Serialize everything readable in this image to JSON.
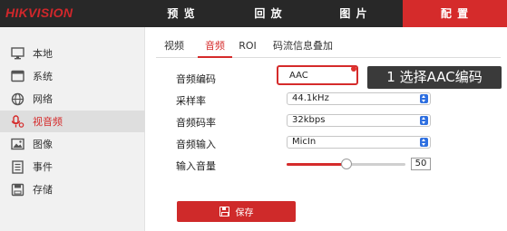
{
  "brand": {
    "logo": "HIKVISION",
    "logo_color": "#d1272b"
  },
  "topnav": [
    {
      "label": "预 览",
      "icon": "none"
    },
    {
      "label": "回 放",
      "icon": "none"
    },
    {
      "label": "图 片",
      "icon": "none"
    },
    {
      "label": "配 置",
      "icon": "none",
      "active": true
    }
  ],
  "sidebar": {
    "items": [
      {
        "label": "本地",
        "icon": "monitor-icon"
      },
      {
        "label": "系统",
        "icon": "window-icon"
      },
      {
        "label": "网络",
        "icon": "globe-icon"
      },
      {
        "label": "视音频",
        "icon": "microphone-icon",
        "active": true
      },
      {
        "label": "图像",
        "icon": "image-icon"
      },
      {
        "label": "事件",
        "icon": "list-icon"
      },
      {
        "label": "存储",
        "icon": "disk-icon"
      }
    ]
  },
  "tabs": [
    {
      "label": "视频"
    },
    {
      "label": "音频",
      "active": true
    },
    {
      "label": "ROI"
    },
    {
      "label": "码流信息叠加"
    }
  ],
  "form": {
    "codec": {
      "label": "音频编码",
      "value": "AAC"
    },
    "sample_rate": {
      "label": "采样率",
      "value": "44.1kHz"
    },
    "bit_rate": {
      "label": "音频码率",
      "value": "32kbps"
    },
    "audio_input": {
      "label": "音频输入",
      "value": "MicIn"
    },
    "volume": {
      "label": "输入音量",
      "value": "50",
      "level": 0.5
    }
  },
  "annotation": {
    "text": "1 选择AAC编码"
  },
  "save": {
    "label": "保存",
    "icon": "save-icon"
  },
  "colors": {
    "accent": "#d52b2b",
    "topbar": "#282828",
    "sidebar": "#f1f1f1",
    "select_caret": "#2e6fe0"
  }
}
